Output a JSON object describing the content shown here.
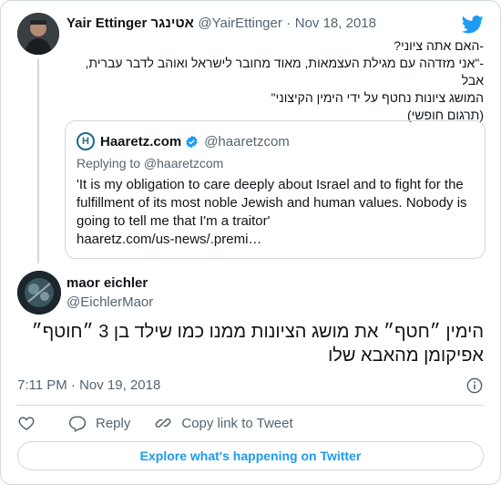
{
  "tweet1": {
    "display_name": "Yair Ettinger אטינגר",
    "handle": "@YairEttinger",
    "separator": "·",
    "date": "Nov 18, 2018",
    "lines": [
      "-האם אתה ציוני?",
      "-\"אני מזדהה עם מגילת העצמאות, מאוד מחובר לישראל ואוהב לדבר עברית, אבל",
      "המושג ציונות נחטף על ידי הימין הקיצוני\"",
      "(תרגום חופשי)"
    ]
  },
  "quote": {
    "logo_letter": "H",
    "display_name": "Haaretz.com",
    "handle": "@haaretzcom",
    "replying_to": "Replying to @haaretzcom",
    "body": "'It is my obligation to care deeply about Israel and to fight for the fulfillment of its most noble Jewish and human values. Nobody is going to tell me that I'm a traitor'",
    "link": "haaretz.com/us-news/.premi…"
  },
  "tweet2": {
    "display_name": "maor eichler",
    "handle": "@EichlerMaor",
    "text": "הימין ״חטף״ את מושג הציונות ממנו כמו שילד בן 3 ״חוטף״ אפיקומן מהאבא שלו",
    "time": "7:11 PM · Nov 19, 2018"
  },
  "actions": {
    "reply": "Reply",
    "copy_link": "Copy link to Tweet"
  },
  "explore_button": "Explore what's happening on Twitter",
  "colors": {
    "twitter_blue": "#1d9bf0",
    "muted_text": "#536471",
    "border": "#cfd9de"
  },
  "icons": [
    "twitter-bird-icon",
    "verified-badge-icon",
    "info-icon",
    "heart-icon",
    "reply-icon",
    "link-icon"
  ]
}
